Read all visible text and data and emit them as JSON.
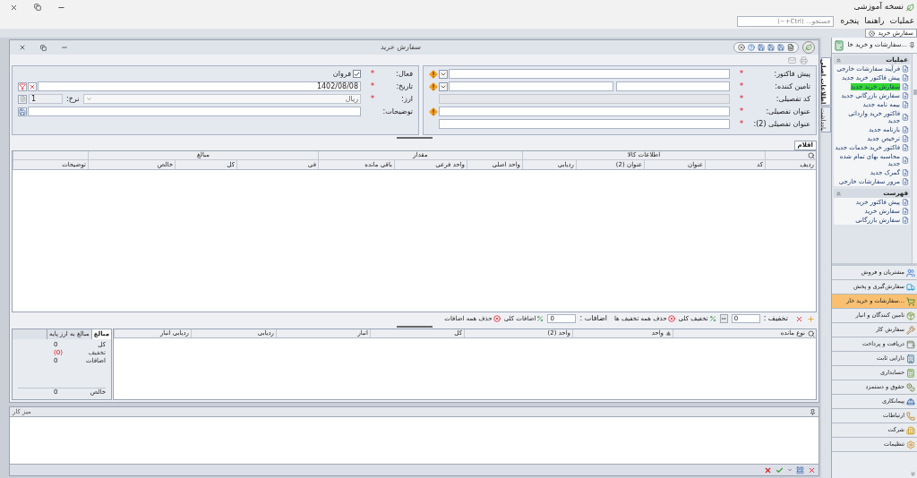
{
  "app": {
    "title": "نسخه آموزشی",
    "menus": [
      "عملیات",
      "راهنما",
      "پنجره"
    ],
    "search": {
      "placeholder": "جستجو... (Ctrl+~)"
    }
  },
  "document_tabs": [
    {
      "label": "سفارش خرید",
      "selected": true
    }
  ],
  "window": {
    "title": "سفارش خرید"
  },
  "side_tabs": [
    {
      "label": "اطلاعات اصلی",
      "selected": true
    },
    {
      "label": "یادداشت",
      "selected": false
    }
  ],
  "form": {
    "required_mark": "*",
    "right": [
      {
        "kind": "combo",
        "label": "پیش فاکتور:",
        "required": true,
        "warning": true
      },
      {
        "kind": "pair",
        "label": "تامین کننده:",
        "required": true,
        "warning": true
      },
      {
        "kind": "disabled",
        "label": "کد تفصیلی:",
        "required": true,
        "warning": false
      },
      {
        "kind": "text",
        "label": "عنوان تفصیلی:",
        "required": true,
        "warning": true
      },
      {
        "kind": "text",
        "label": "عنوان تفصیلی (2):",
        "required": true,
        "warning": false
      }
    ],
    "left": [
      {
        "kind": "checkbox",
        "label": "فعال:",
        "required": true,
        "checked": true,
        "text": "فروان"
      },
      {
        "kind": "date",
        "label": "تاریخ:",
        "required": true,
        "value": "1402/08/08"
      },
      {
        "kind": "currency",
        "label": "ارز:",
        "required": true,
        "value": "ریال",
        "rate_label": "نرخ:",
        "rate": "1"
      },
      {
        "kind": "notes",
        "label": "توضیحات:",
        "required": false
      }
    ]
  },
  "items_tab": {
    "label": "اقلام",
    "selected": true
  },
  "items_grid": {
    "groups": [
      {
        "columns": [
          "ردیف"
        ]
      },
      {
        "label": "اطلاعات کالا",
        "columns": [
          "کد",
          "عنوان",
          "عنوان (2)",
          "ردیابی"
        ]
      },
      {
        "label": "مقدار",
        "columns": [
          "واحد اصلی",
          "واحد فرعی",
          "باقی مانده"
        ]
      },
      {
        "label": "مبالغ",
        "columns": [
          "فی",
          "کل",
          "خالص"
        ]
      },
      {
        "columns": [
          "توضیحات"
        ]
      }
    ]
  },
  "adjustments": {
    "discount_label": "تخفیف :",
    "discount": "0",
    "discount_buttons": [
      "تخفیف کلی",
      "حذف همه تخفیف ها"
    ],
    "additions_label": "اضافات :",
    "additions": "0",
    "additions_buttons": [
      "اضافات کلی",
      "حذف همه اضافات"
    ]
  },
  "stock_grid": {
    "columns": [
      {
        "label": "نوع مانده",
        "sorted": false
      },
      {
        "label": "واحد",
        "sorted": true
      },
      {
        "label": "واحد (2)",
        "sorted": false
      },
      {
        "label": "کل",
        "sorted": false
      },
      {
        "label": "انبار",
        "sorted": false
      },
      {
        "label": "ردیابی",
        "sorted": false
      },
      {
        "label": "ردیابی انبار",
        "sorted": false
      }
    ]
  },
  "totals": {
    "tabs": [
      {
        "label": "مبالغ",
        "selected": true
      },
      {
        "label": "مبالغ به ارز پایه",
        "selected": false
      }
    ],
    "rows": [
      {
        "kind": "plain",
        "label": "کل",
        "value": "0"
      },
      {
        "kind": "negative",
        "label": "تخفیف",
        "value": "(0)"
      },
      {
        "kind": "plain",
        "label": "اضافات",
        "value": "0"
      },
      {
        "kind": "total",
        "label": "خالص",
        "value": "0"
      }
    ]
  },
  "work_desk": {
    "title": "میز کار"
  },
  "sidebar": {
    "header": "...سفارشات و خرید خا",
    "sections": [
      {
        "title": "عملیات",
        "expanded": true,
        "items": [
          {
            "label": "فرآیند سفارشات خارجی",
            "selected": false
          },
          {
            "label": "پیش فاکتور خرید جدید",
            "selected": false
          },
          {
            "label": "سفارش خرید جدید",
            "selected": true
          },
          {
            "label": "سفارش بازرگانی جدید",
            "selected": false
          },
          {
            "label": "بیمه نامه جدید",
            "selected": false
          },
          {
            "label": "فاکتور خرید وارداتی جدید",
            "selected": false
          },
          {
            "label": "بارنامه جدید",
            "selected": false
          },
          {
            "label": "ترخیص جدید",
            "selected": false
          },
          {
            "label": "فاکتور خرید خدمات جدید",
            "selected": false
          },
          {
            "label": "محاسبه بهای تمام شده جدید",
            "selected": false
          },
          {
            "label": "گمرک جدید",
            "selected": false
          },
          {
            "label": "مرور سفارشات خارجی",
            "selected": false
          }
        ]
      },
      {
        "title": "فهرست",
        "expanded": true,
        "items": [
          {
            "label": "پیش فاکتور خرید",
            "selected": false
          },
          {
            "label": "سفارش خرید",
            "selected": false
          },
          {
            "label": "سفارش بازرگانی",
            "selected": false
          }
        ]
      }
    ],
    "modules": [
      {
        "label": "مشتریان و فروش",
        "selected": false
      },
      {
        "label": "سفارش‌گیری و پخش",
        "selected": false
      },
      {
        "label": "...سفارشات و خرید خار",
        "selected": true
      },
      {
        "label": "تامین کنندگان و انبار",
        "selected": false
      },
      {
        "label": "سفارش کار",
        "selected": false
      },
      {
        "label": "دریافت و پرداخت",
        "selected": false
      },
      {
        "label": "دارایی ثابت",
        "selected": false
      },
      {
        "label": "حسابداری",
        "selected": false
      },
      {
        "label": "حقوق و دستمزد",
        "selected": false
      },
      {
        "label": "پیمانکاری",
        "selected": false
      },
      {
        "label": "ارتباطات",
        "selected": false
      },
      {
        "label": "شرکت",
        "selected": false
      },
      {
        "label": "تنظیمات",
        "selected": false
      }
    ]
  }
}
